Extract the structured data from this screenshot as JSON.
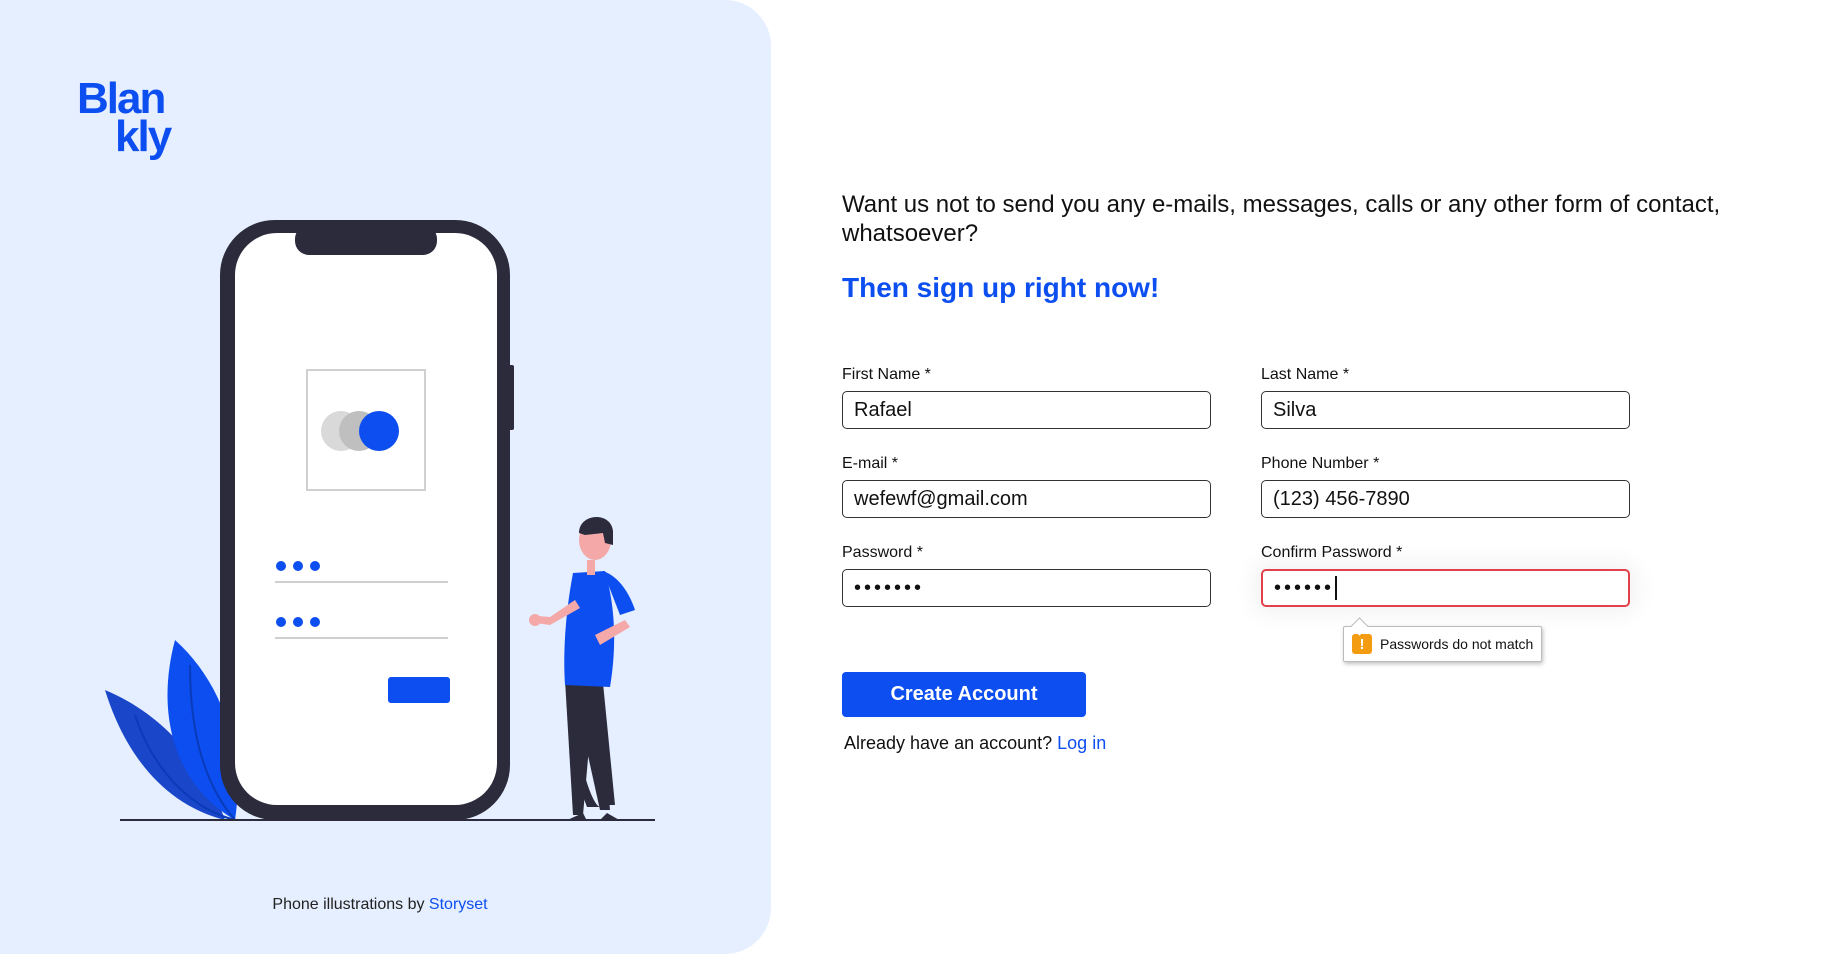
{
  "brand": {
    "logo_line1": "Blan",
    "logo_line2": "kly",
    "accent_color": "#0d4ef0"
  },
  "left_panel": {
    "credit_prefix": "Phone illustrations by ",
    "credit_link": "Storyset"
  },
  "intro": {
    "text": "Want us not to send you any e-mails, messages, calls or any other form of contact, whatsoever?",
    "cta": "Then sign up right now!"
  },
  "form": {
    "first_name": {
      "label": "First Name *",
      "value": "Rafael"
    },
    "last_name": {
      "label": "Last Name *",
      "value": "Silva"
    },
    "email": {
      "label": "E-mail *",
      "value": "wefewf@gmail.com"
    },
    "phone": {
      "label": "Phone Number *",
      "value": "(123) 456-7890"
    },
    "password": {
      "label": "Password *",
      "value": "•••••••"
    },
    "confirm_password": {
      "label": "Confirm Password *",
      "value": "••••••"
    },
    "error_tooltip": "Passwords do not match",
    "error_color": "#e2414b",
    "submit_label": "Create Account"
  },
  "login": {
    "prefix": "Already have an account? ",
    "link": "Log in"
  }
}
